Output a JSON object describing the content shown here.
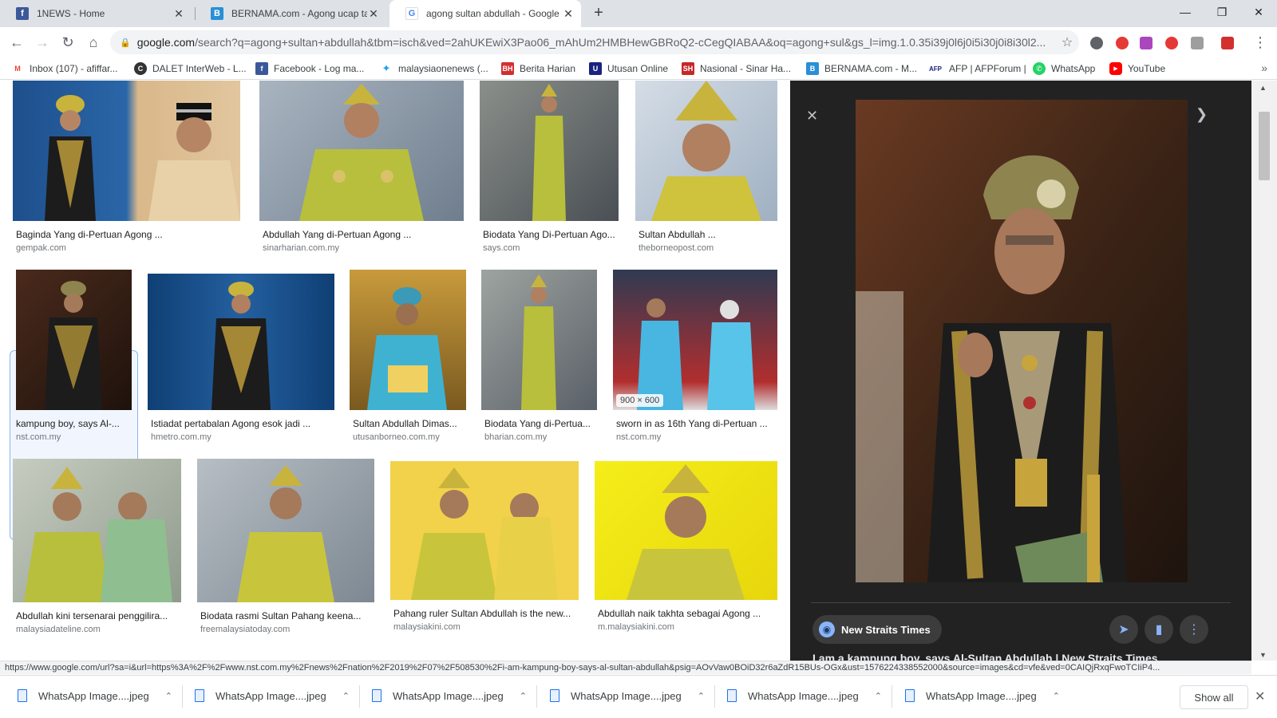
{
  "tabs": [
    {
      "title": "1NEWS - Home",
      "icon": "facebook-icon",
      "color": "#3b5998"
    },
    {
      "title": "BERNAMA.com - Agong ucap tal",
      "icon": "bernama-icon",
      "color": "#2a8fd6"
    },
    {
      "title": "agong sultan abdullah - Google",
      "icon": "google-icon",
      "color": "#4285f4"
    }
  ],
  "url": {
    "host": "google.com",
    "rest": "/search?q=agong+sultan+abdullah&tbm=isch&ved=2ahUKEwiX3Pao06_mAhUm2HMBHewGBRoQ2-cCegQIABAA&oq=agong+sul&gs_l=img.1.0.35i39j0l6j0i5i30j0i8i30l2..."
  },
  "bookmarks": [
    {
      "label": "Inbox (107) - afiffar...",
      "icon": "gmail-icon",
      "color": "#ea4335",
      "glyph": "M"
    },
    {
      "label": "DALET InterWeb - L...",
      "icon": "dalet-icon",
      "color": "#333333",
      "glyph": "C"
    },
    {
      "label": "Facebook - Log ma...",
      "icon": "facebook-icon",
      "color": "#3b5998",
      "glyph": "f"
    },
    {
      "label": "malaysiaonenews (...",
      "icon": "twitter-icon",
      "color": "#1da1f2",
      "glyph": "t"
    },
    {
      "label": "Berita Harian",
      "icon": "berita-harian-icon",
      "color": "#d32f2f",
      "glyph": "BH"
    },
    {
      "label": "Utusan Online",
      "icon": "utusan-icon",
      "color": "#1a237e",
      "glyph": "U"
    },
    {
      "label": "Nasional - Sinar Ha...",
      "icon": "sinar-harian-icon",
      "color": "#c62828",
      "glyph": "SH"
    },
    {
      "label": "BERNAMA.com - M...",
      "icon": "bernama-icon",
      "color": "#2a8fd6",
      "glyph": "B"
    },
    {
      "label": "AFP | AFPForum |",
      "icon": "afp-icon",
      "color": "#1a237e",
      "glyph": "AFP"
    },
    {
      "label": "WhatsApp",
      "icon": "whatsapp-icon",
      "color": "#25d366",
      "glyph": "W"
    },
    {
      "label": "YouTube",
      "icon": "youtube-icon",
      "color": "#ff0000",
      "glyph": "▶"
    }
  ],
  "results": [
    {
      "caption": "Baginda Yang di-Pertuan Agong ...",
      "source": "gempak.com"
    },
    {
      "caption": "Abdullah Yang di-Pertuan Agong ...",
      "source": "sinarharian.com.my"
    },
    {
      "caption": "Biodata Yang Di-Pertuan Ago...",
      "source": "says.com"
    },
    {
      "caption": "Sultan Abdullah ...",
      "source": "theborneopost.com"
    },
    {
      "caption": "kampung boy, says Al-...",
      "source": "nst.com.my"
    },
    {
      "caption": "Istiadat pertabalan Agong esok jadi ...",
      "source": "hmetro.com.my"
    },
    {
      "caption": "Sultan Abdullah Dimas...",
      "source": "utusanborneo.com.my"
    },
    {
      "caption": "Biodata Yang di-Pertua...",
      "source": "bharian.com.my"
    },
    {
      "caption": "sworn in as 16th Yang di-Pertuan ...",
      "source": "nst.com.my"
    },
    {
      "caption": "Abdullah kini tersenarai penggilira...",
      "source": "malaysiadateline.com"
    },
    {
      "caption": "Biodata rasmi Sultan Pahang keena...",
      "source": "freemalaysiatoday.com"
    },
    {
      "caption": "Pahang ruler Sultan Abdullah is the new...",
      "source": "malaysiakini.com"
    },
    {
      "caption": "Abdullah naik takhta sebagai Agong ...",
      "source": "m.malaysiakini.com"
    }
  ],
  "hover_dims": "900 × 600",
  "preview": {
    "source_name": "New Straits Times",
    "title": "I am a kampung boy, says Al-Sultan Abdullah | New Straits Times"
  },
  "status_url": "https://www.google.com/url?sa=i&url=https%3A%2F%2Fwww.nst.com.my%2Fnews%2Fnation%2F2019%2F07%2F508530%2Fi-am-kampung-boy-says-al-sultan-abdullah&psig=AOvVaw0BOiD32r6aZdR15BUs-OGx&ust=1576224338552000&source=images&cd=vfe&ved=0CAIQjRxqFwoTCIiP4...",
  "downloads": [
    {
      "name": "WhatsApp Image....jpeg"
    },
    {
      "name": "WhatsApp Image....jpeg"
    },
    {
      "name": "WhatsApp Image....jpeg"
    },
    {
      "name": "WhatsApp Image....jpeg"
    },
    {
      "name": "WhatsApp Image....jpeg"
    },
    {
      "name": "WhatsApp Image....jpeg"
    }
  ],
  "show_all_label": "Show all",
  "colors": {
    "gold": "#c8b43c",
    "royal_black": "#1c1c1c",
    "accent_blue": "#1a73e8"
  }
}
